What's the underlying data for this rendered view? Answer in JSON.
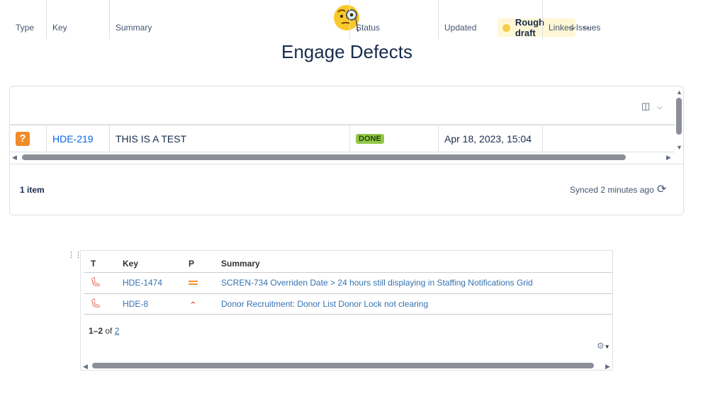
{
  "header": {
    "emoji_name": "face-with-monocle-icon",
    "status": "Rough draft",
    "title": "Engage Defects"
  },
  "jira_table": {
    "columns": [
      "Type",
      "Key",
      "Summary",
      "Status",
      "Updated",
      "Linked Issues"
    ],
    "rows": [
      {
        "type_icon": "?",
        "key": "HDE-219",
        "summary": "THIS IS A TEST",
        "status": "DONE",
        "updated": "Apr 18, 2023, 15:04",
        "linked": ""
      }
    ],
    "item_count": "1 item",
    "synced": "Synced 2 minutes ago"
  },
  "issues_macro": {
    "columns": [
      "T",
      "Key",
      "P",
      "Summary"
    ],
    "rows": [
      {
        "key": "HDE-1474",
        "priority": "medium",
        "summary": "SCREN-734 Overriden Date > 24 hours still displaying in Staffing Notifications Grid"
      },
      {
        "key": "HDE-8",
        "priority": "high",
        "summary": "Donor Recruitment: Donor List Donor Lock not clearing"
      }
    ],
    "pager_range": "1–2",
    "pager_of": "of",
    "pager_total": "2"
  }
}
